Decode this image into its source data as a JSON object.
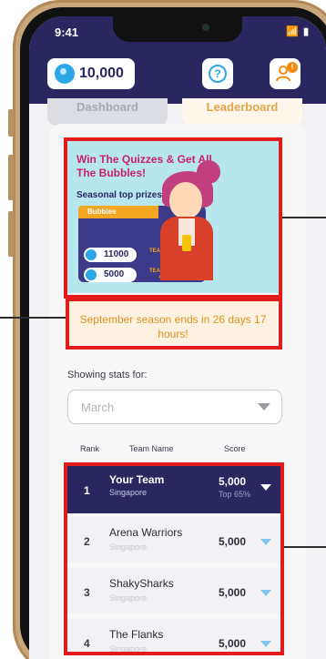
{
  "status_bar": {
    "time": "9:41",
    "icons": "📶 ▮"
  },
  "header": {
    "coins": "10,000",
    "help_symbol": "?",
    "notification_count": "!"
  },
  "tabs": {
    "dashboard": "Dashboard",
    "leaderboard": "Leaderboard"
  },
  "banner": {
    "title": "Win The Quizzes & Get All The Bubbles!",
    "subtitle": "Seasonal top prizes:",
    "tag": "Bubbles",
    "prizes": [
      {
        "amount": "11000",
        "rank": "TEAM RANK\n1 - 3"
      },
      {
        "amount": "5000",
        "rank": "TEAM RANK\n4 - 10"
      }
    ]
  },
  "season_notice": "September season ends in 26 days 17 hours!",
  "stats": {
    "label": "Showing stats for:",
    "month": "March"
  },
  "leaderboard": {
    "columns": {
      "rank": "Rank",
      "team": "Team Name",
      "score": "Score"
    },
    "rows": [
      {
        "rank": "1",
        "name": "Your Team",
        "country": "Singapore",
        "score": "5,000",
        "top": "Top 65%"
      },
      {
        "rank": "2",
        "name": "Arena Warriors",
        "country": "Singapore",
        "score": "5,000"
      },
      {
        "rank": "3",
        "name": "ShakySharks",
        "country": "Singapore",
        "score": "5,000"
      },
      {
        "rank": "4",
        "name": "The Flanks",
        "country": "Singapore",
        "score": "5,000"
      }
    ]
  },
  "colors": {
    "primary": "#2a2760",
    "accent": "#2aa7e6",
    "highlight": "#e21b1b",
    "season_text": "#e0911e"
  }
}
